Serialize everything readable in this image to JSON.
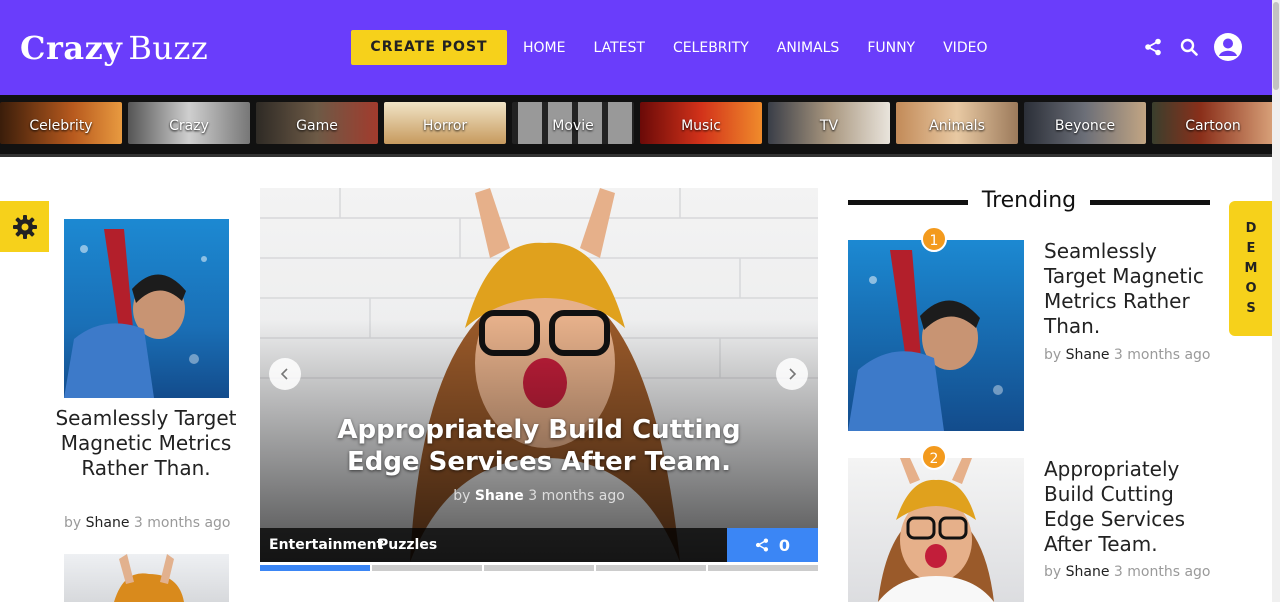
{
  "header": {
    "logo_bold": "Crazy",
    "logo_light": "Buzz",
    "create_post": "CREATE POST",
    "nav": [
      "HOME",
      "LATEST",
      "CELEBRITY",
      "ANIMALS",
      "FUNNY",
      "VIDEO"
    ],
    "icons": [
      "share-icon",
      "search-icon",
      "user-icon"
    ],
    "bg_color": "#6a3dfb",
    "accent_color": "#f6d11b"
  },
  "categories": [
    "Celebrity",
    "Crazy",
    "Game",
    "Horror",
    "Movie",
    "Music",
    "TV",
    "Animals",
    "Beyonce",
    "Cartoon"
  ],
  "left_card": {
    "title": "Seamlessly Target Magnetic Metrics Rather Than.",
    "by": "by",
    "author": "Shane",
    "time": "3 months ago"
  },
  "slider": {
    "title": "Appropriately Build Cutting Edge Services After Team.",
    "by": "by",
    "author": "Shane",
    "time": "3 months ago",
    "tags": [
      "Entertainment",
      "Puzzles"
    ],
    "share_count": "0",
    "slide_count": 5,
    "active_slide": 1
  },
  "trending": {
    "heading": "Trending",
    "items": [
      {
        "rank": "1",
        "title": "Seamlessly Target Magnetic Metrics Rather Than.",
        "by": "by",
        "author": "Shane",
        "time": "3 months ago"
      },
      {
        "rank": "2",
        "title": "Appropriately Build Cutting Edge Services After Team.",
        "by": "by",
        "author": "Shane",
        "time": "3 months ago"
      }
    ]
  },
  "demos_tab": [
    "D",
    "E",
    "M",
    "O",
    "S"
  ]
}
